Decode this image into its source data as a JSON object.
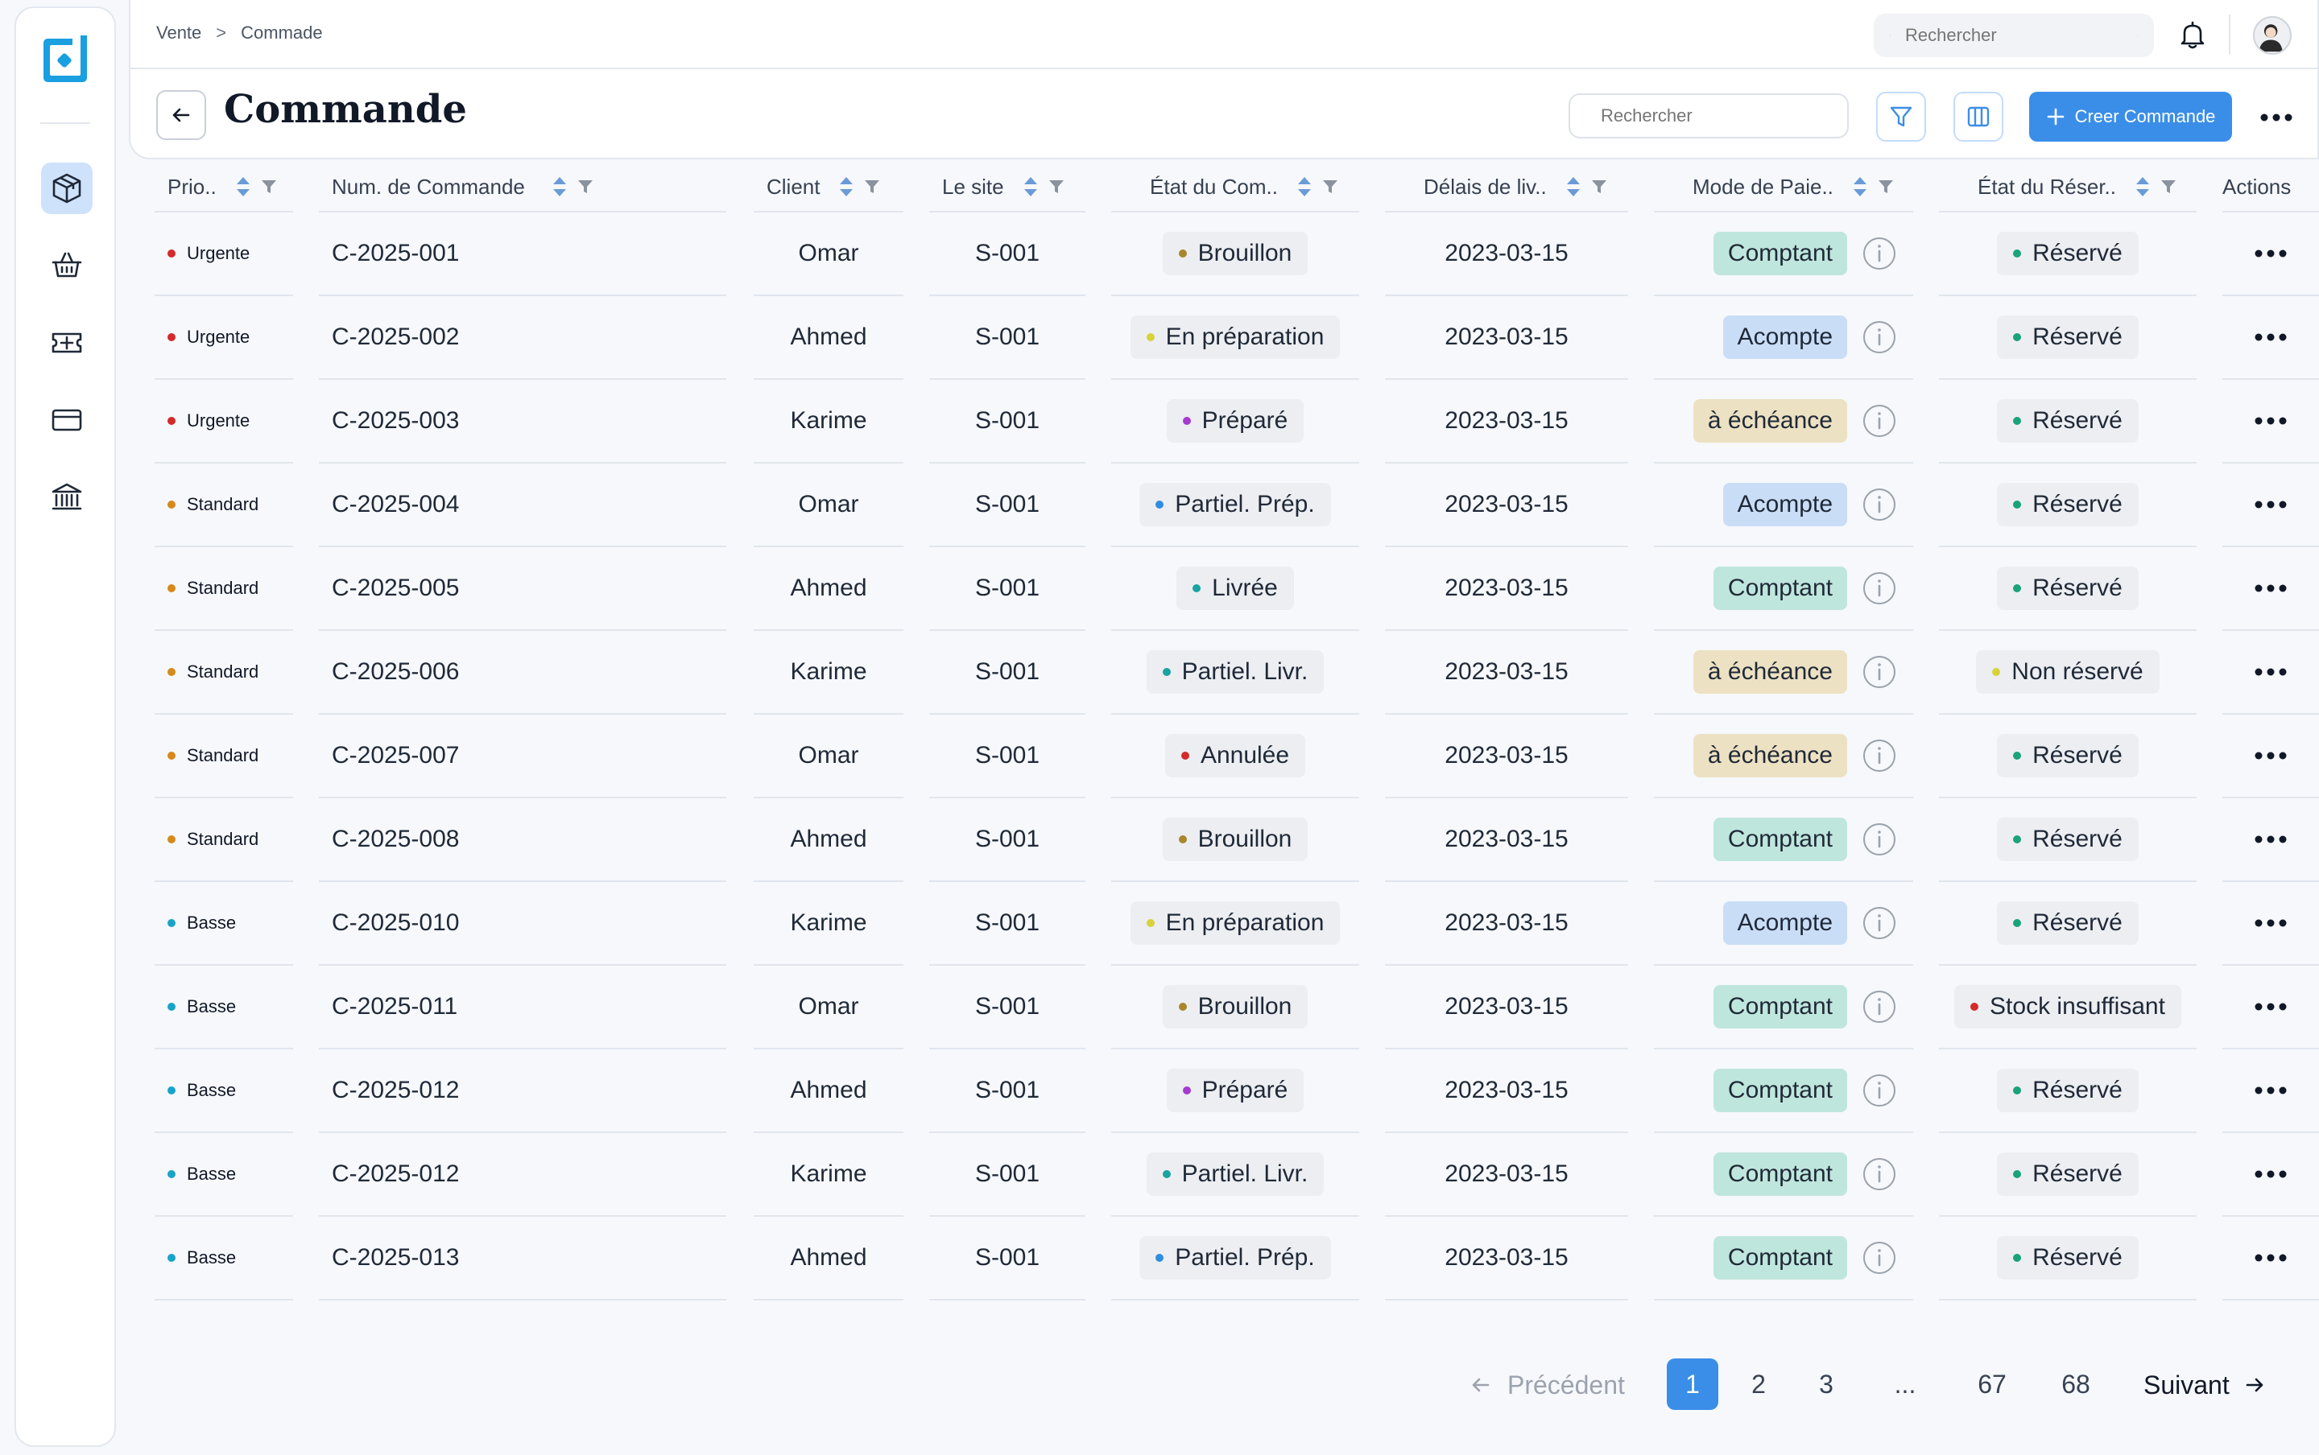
{
  "breadcrumb": [
    "Vente",
    "Commade"
  ],
  "breadcrumb_sep": ">",
  "top_search": {
    "placeholder": "Rechercher"
  },
  "page": {
    "title": "Commande"
  },
  "main_search": {
    "placeholder": "Rechercher"
  },
  "create_button": {
    "label": "Creer Commande"
  },
  "colors": {
    "accent": "#3b8ee8",
    "urgent": "#d42a2a",
    "standard": "#d68a1b",
    "basse": "#1aa3c9",
    "comptant_bg": "#bfe6dc",
    "acompte_bg": "#c9ddf7",
    "echeance_bg": "#ece1c2"
  },
  "sidebar": {
    "items": [
      {
        "icon": "box-icon",
        "active": true
      },
      {
        "icon": "basket-icon",
        "active": false
      },
      {
        "icon": "ticket-icon",
        "active": false
      },
      {
        "icon": "card-icon",
        "active": false
      },
      {
        "icon": "bank-icon",
        "active": false
      }
    ]
  },
  "table": {
    "headers": {
      "prio": "Prio..",
      "num": "Num. de Commande",
      "client": "Client",
      "site": "Le site",
      "etat": "État du Com..",
      "delais": "Délais de liv..",
      "mode": "Mode de Paie..",
      "reserv": "État du Réser..",
      "actions": "Actions"
    },
    "rows": [
      {
        "prio": "Urgente",
        "prio_color": "#d42a2a",
        "num": "C-2025-001",
        "client": "Omar",
        "site": "S-001",
        "etat": "Brouillon",
        "etat_color": "#a8862c",
        "delais": "2023-03-15",
        "mode": "Comptant",
        "mode_bg": "#bfe6dc",
        "reserv": "Réservé",
        "reserv_color": "#1aa37a"
      },
      {
        "prio": "Urgente",
        "prio_color": "#d42a2a",
        "num": "C-2025-002",
        "client": "Ahmed",
        "site": "S-001",
        "etat": "En préparation",
        "etat_color": "#d8d23a",
        "delais": "2023-03-15",
        "mode": "Acompte",
        "mode_bg": "#c9ddf7",
        "reserv": "Réservé",
        "reserv_color": "#1aa37a"
      },
      {
        "prio": "Urgente",
        "prio_color": "#d42a2a",
        "num": "C-2025-003",
        "client": "Karime",
        "site": "S-001",
        "etat": "Préparé",
        "etat_color": "#a53ad0",
        "delais": "2023-03-15",
        "mode": "à échéance",
        "mode_bg": "#ece1c2",
        "reserv": "Réservé",
        "reserv_color": "#1aa37a"
      },
      {
        "prio": "Standard",
        "prio_color": "#d68a1b",
        "num": "C-2025-004",
        "client": "Omar",
        "site": "S-001",
        "etat": "Partiel. Prép.",
        "etat_color": "#2f8ee0",
        "delais": "2023-03-15",
        "mode": "Acompte",
        "mode_bg": "#c9ddf7",
        "reserv": "Réservé",
        "reserv_color": "#1aa37a"
      },
      {
        "prio": "Standard",
        "prio_color": "#d68a1b",
        "num": "C-2025-005",
        "client": "Ahmed",
        "site": "S-001",
        "etat": "Livrée",
        "etat_color": "#1aa3a0",
        "delais": "2023-03-15",
        "mode": "Comptant",
        "mode_bg": "#bfe6dc",
        "reserv": "Réservé",
        "reserv_color": "#1aa37a"
      },
      {
        "prio": "Standard",
        "prio_color": "#d68a1b",
        "num": "C-2025-006",
        "client": "Karime",
        "site": "S-001",
        "etat": "Partiel. Livr.",
        "etat_color": "#1aa3a0",
        "delais": "2023-03-15",
        "mode": "à échéance",
        "mode_bg": "#ece1c2",
        "reserv": "Non réservé",
        "reserv_color": "#d8d23a"
      },
      {
        "prio": "Standard",
        "prio_color": "#d68a1b",
        "num": "C-2025-007",
        "client": "Omar",
        "site": "S-001",
        "etat": "Annulée",
        "etat_color": "#d42a2a",
        "delais": "2023-03-15",
        "mode": "à échéance",
        "mode_bg": "#ece1c2",
        "reserv": "Réservé",
        "reserv_color": "#1aa37a"
      },
      {
        "prio": "Standard",
        "prio_color": "#d68a1b",
        "num": "C-2025-008",
        "client": "Ahmed",
        "site": "S-001",
        "etat": "Brouillon",
        "etat_color": "#a8862c",
        "delais": "2023-03-15",
        "mode": "Comptant",
        "mode_bg": "#bfe6dc",
        "reserv": "Réservé",
        "reserv_color": "#1aa37a"
      },
      {
        "prio": "Basse",
        "prio_color": "#1aa3c9",
        "num": "C-2025-010",
        "client": "Karime",
        "site": "S-001",
        "etat": "En préparation",
        "etat_color": "#d8d23a",
        "delais": "2023-03-15",
        "mode": "Acompte",
        "mode_bg": "#c9ddf7",
        "reserv": "Réservé",
        "reserv_color": "#1aa37a"
      },
      {
        "prio": "Basse",
        "prio_color": "#1aa3c9",
        "num": "C-2025-011",
        "client": "Omar",
        "site": "S-001",
        "etat": "Brouillon",
        "etat_color": "#a8862c",
        "delais": "2023-03-15",
        "mode": "Comptant",
        "mode_bg": "#bfe6dc",
        "reserv": "Stock insuffisant",
        "reserv_color": "#d42a2a"
      },
      {
        "prio": "Basse",
        "prio_color": "#1aa3c9",
        "num": "C-2025-012",
        "client": "Ahmed",
        "site": "S-001",
        "etat": "Préparé",
        "etat_color": "#a53ad0",
        "delais": "2023-03-15",
        "mode": "Comptant",
        "mode_bg": "#bfe6dc",
        "reserv": "Réservé",
        "reserv_color": "#1aa37a"
      },
      {
        "prio": "Basse",
        "prio_color": "#1aa3c9",
        "num": "C-2025-012",
        "client": "Karime",
        "site": "S-001",
        "etat": "Partiel. Livr.",
        "etat_color": "#1aa3a0",
        "delais": "2023-03-15",
        "mode": "Comptant",
        "mode_bg": "#bfe6dc",
        "reserv": "Réservé",
        "reserv_color": "#1aa37a"
      },
      {
        "prio": "Basse",
        "prio_color": "#1aa3c9",
        "num": "C-2025-013",
        "client": "Ahmed",
        "site": "S-001",
        "etat": "Partiel. Prép.",
        "etat_color": "#2f8ee0",
        "delais": "2023-03-15",
        "mode": "Comptant",
        "mode_bg": "#bfe6dc",
        "reserv": "Réservé",
        "reserv_color": "#1aa37a"
      }
    ]
  },
  "pagination": {
    "prev": "Précédent",
    "next": "Suivant",
    "pages": [
      "1",
      "2",
      "3",
      "...",
      "67",
      "68"
    ],
    "current": "1"
  }
}
